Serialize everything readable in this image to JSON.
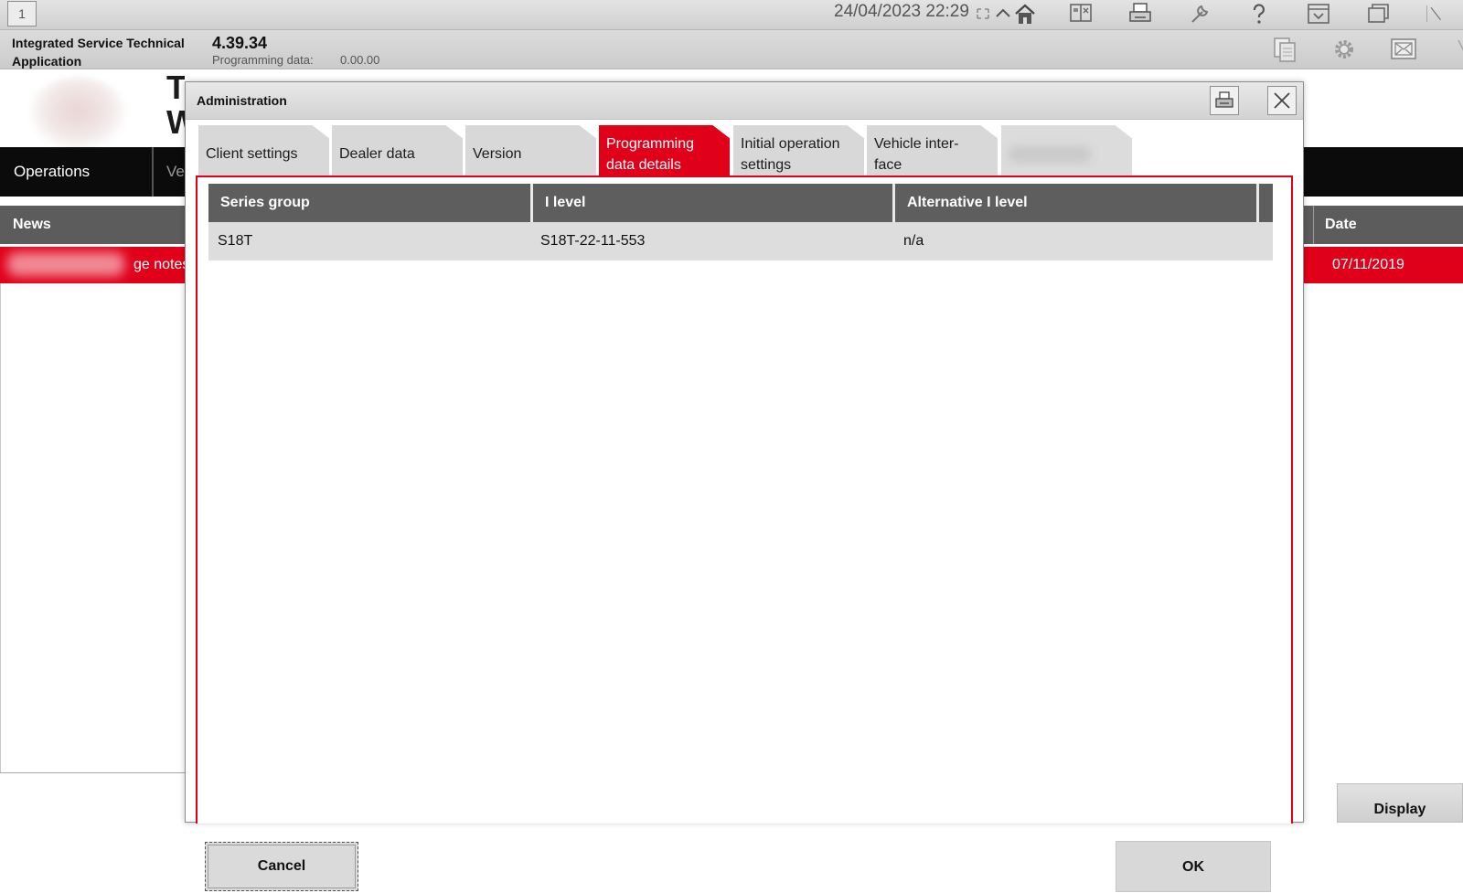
{
  "topbar": {
    "window_number": "1",
    "datetime": "24/04/2023 22:29",
    "icons": [
      "fullscreen-icon",
      "chevron-up-icon",
      "home-icon",
      "split-view-icon",
      "print-icon",
      "wrench-icon",
      "help-icon",
      "dropdown-panel-icon",
      "window-restore-icon",
      "close-icon"
    ]
  },
  "header": {
    "app_name": "Integrated Service Technical Application",
    "version": "4.39.34",
    "programming_label": "Programming data:",
    "programming_value": "0.00.00",
    "icons": [
      "copy-icon",
      "gear-icon",
      "mail-icon"
    ]
  },
  "background": {
    "title_fragment": "T",
    "title_fragment_2": "W",
    "nav": {
      "operations": "Operations",
      "vehicle_fragment": "Ve"
    },
    "news_header": {
      "news": "News",
      "date": "Date"
    },
    "news_row": {
      "text": "ge notes",
      "date": "07/11/2019"
    },
    "display_button": "Display"
  },
  "modal": {
    "title": "Administration",
    "tabs": [
      {
        "label": "Client settings"
      },
      {
        "label": "Dealer data"
      },
      {
        "label": "Version"
      },
      {
        "label": "Programming data details",
        "line1": "Programming",
        "line2": "data details",
        "active": true
      },
      {
        "label": "Initial operation settings",
        "line1": "Initial operation",
        "line2": "settings"
      },
      {
        "label": "Vehicle interface",
        "line1": "Vehicle inter-",
        "line2": "face"
      },
      {
        "label": ""
      }
    ],
    "table": {
      "columns": [
        "Series group",
        "I level",
        "Alternative I level"
      ],
      "rows": [
        [
          "S18T",
          "S18T-22-11-553",
          "n/a"
        ]
      ]
    },
    "buttons": {
      "cancel": "Cancel",
      "ok": "OK"
    }
  },
  "colors": {
    "accent": "#e1001a",
    "table_header": "#5e5e5e",
    "row_bg": "#dddddd",
    "nav_bg": "#0b0b0b"
  }
}
